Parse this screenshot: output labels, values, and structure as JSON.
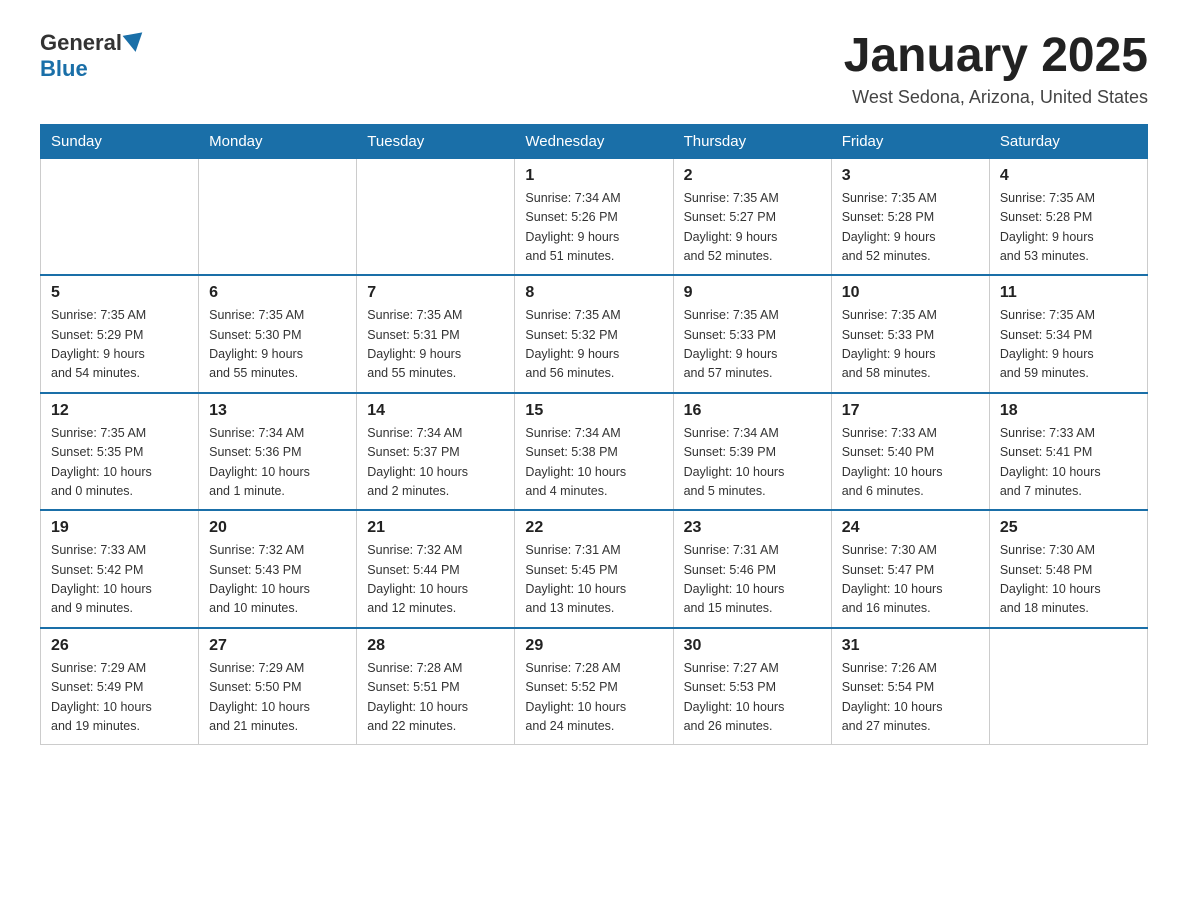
{
  "header": {
    "logo_general": "General",
    "logo_blue": "Blue",
    "month_title": "January 2025",
    "location": "West Sedona, Arizona, United States"
  },
  "days_of_week": [
    "Sunday",
    "Monday",
    "Tuesday",
    "Wednesday",
    "Thursday",
    "Friday",
    "Saturday"
  ],
  "weeks": [
    [
      {
        "day": "",
        "info": ""
      },
      {
        "day": "",
        "info": ""
      },
      {
        "day": "",
        "info": ""
      },
      {
        "day": "1",
        "info": "Sunrise: 7:34 AM\nSunset: 5:26 PM\nDaylight: 9 hours\nand 51 minutes."
      },
      {
        "day": "2",
        "info": "Sunrise: 7:35 AM\nSunset: 5:27 PM\nDaylight: 9 hours\nand 52 minutes."
      },
      {
        "day": "3",
        "info": "Sunrise: 7:35 AM\nSunset: 5:28 PM\nDaylight: 9 hours\nand 52 minutes."
      },
      {
        "day": "4",
        "info": "Sunrise: 7:35 AM\nSunset: 5:28 PM\nDaylight: 9 hours\nand 53 minutes."
      }
    ],
    [
      {
        "day": "5",
        "info": "Sunrise: 7:35 AM\nSunset: 5:29 PM\nDaylight: 9 hours\nand 54 minutes."
      },
      {
        "day": "6",
        "info": "Sunrise: 7:35 AM\nSunset: 5:30 PM\nDaylight: 9 hours\nand 55 minutes."
      },
      {
        "day": "7",
        "info": "Sunrise: 7:35 AM\nSunset: 5:31 PM\nDaylight: 9 hours\nand 55 minutes."
      },
      {
        "day": "8",
        "info": "Sunrise: 7:35 AM\nSunset: 5:32 PM\nDaylight: 9 hours\nand 56 minutes."
      },
      {
        "day": "9",
        "info": "Sunrise: 7:35 AM\nSunset: 5:33 PM\nDaylight: 9 hours\nand 57 minutes."
      },
      {
        "day": "10",
        "info": "Sunrise: 7:35 AM\nSunset: 5:33 PM\nDaylight: 9 hours\nand 58 minutes."
      },
      {
        "day": "11",
        "info": "Sunrise: 7:35 AM\nSunset: 5:34 PM\nDaylight: 9 hours\nand 59 minutes."
      }
    ],
    [
      {
        "day": "12",
        "info": "Sunrise: 7:35 AM\nSunset: 5:35 PM\nDaylight: 10 hours\nand 0 minutes."
      },
      {
        "day": "13",
        "info": "Sunrise: 7:34 AM\nSunset: 5:36 PM\nDaylight: 10 hours\nand 1 minute."
      },
      {
        "day": "14",
        "info": "Sunrise: 7:34 AM\nSunset: 5:37 PM\nDaylight: 10 hours\nand 2 minutes."
      },
      {
        "day": "15",
        "info": "Sunrise: 7:34 AM\nSunset: 5:38 PM\nDaylight: 10 hours\nand 4 minutes."
      },
      {
        "day": "16",
        "info": "Sunrise: 7:34 AM\nSunset: 5:39 PM\nDaylight: 10 hours\nand 5 minutes."
      },
      {
        "day": "17",
        "info": "Sunrise: 7:33 AM\nSunset: 5:40 PM\nDaylight: 10 hours\nand 6 minutes."
      },
      {
        "day": "18",
        "info": "Sunrise: 7:33 AM\nSunset: 5:41 PM\nDaylight: 10 hours\nand 7 minutes."
      }
    ],
    [
      {
        "day": "19",
        "info": "Sunrise: 7:33 AM\nSunset: 5:42 PM\nDaylight: 10 hours\nand 9 minutes."
      },
      {
        "day": "20",
        "info": "Sunrise: 7:32 AM\nSunset: 5:43 PM\nDaylight: 10 hours\nand 10 minutes."
      },
      {
        "day": "21",
        "info": "Sunrise: 7:32 AM\nSunset: 5:44 PM\nDaylight: 10 hours\nand 12 minutes."
      },
      {
        "day": "22",
        "info": "Sunrise: 7:31 AM\nSunset: 5:45 PM\nDaylight: 10 hours\nand 13 minutes."
      },
      {
        "day": "23",
        "info": "Sunrise: 7:31 AM\nSunset: 5:46 PM\nDaylight: 10 hours\nand 15 minutes."
      },
      {
        "day": "24",
        "info": "Sunrise: 7:30 AM\nSunset: 5:47 PM\nDaylight: 10 hours\nand 16 minutes."
      },
      {
        "day": "25",
        "info": "Sunrise: 7:30 AM\nSunset: 5:48 PM\nDaylight: 10 hours\nand 18 minutes."
      }
    ],
    [
      {
        "day": "26",
        "info": "Sunrise: 7:29 AM\nSunset: 5:49 PM\nDaylight: 10 hours\nand 19 minutes."
      },
      {
        "day": "27",
        "info": "Sunrise: 7:29 AM\nSunset: 5:50 PM\nDaylight: 10 hours\nand 21 minutes."
      },
      {
        "day": "28",
        "info": "Sunrise: 7:28 AM\nSunset: 5:51 PM\nDaylight: 10 hours\nand 22 minutes."
      },
      {
        "day": "29",
        "info": "Sunrise: 7:28 AM\nSunset: 5:52 PM\nDaylight: 10 hours\nand 24 minutes."
      },
      {
        "day": "30",
        "info": "Sunrise: 7:27 AM\nSunset: 5:53 PM\nDaylight: 10 hours\nand 26 minutes."
      },
      {
        "day": "31",
        "info": "Sunrise: 7:26 AM\nSunset: 5:54 PM\nDaylight: 10 hours\nand 27 minutes."
      },
      {
        "day": "",
        "info": ""
      }
    ]
  ]
}
